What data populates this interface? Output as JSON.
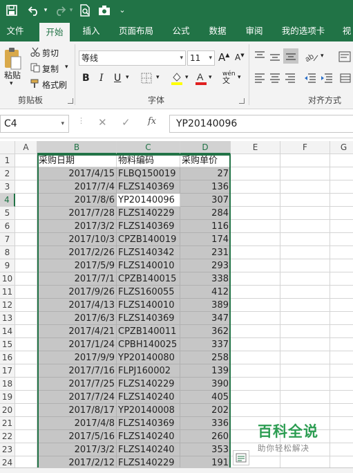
{
  "qat": {
    "save_icon": "save-icon",
    "undo_icon": "undo-icon",
    "redo_icon": "redo-icon",
    "print_preview_icon": "print-preview-icon",
    "camera_icon": "camera-icon",
    "customize_icon": "customize-qat-icon"
  },
  "tabs": [
    "文件",
    "开始",
    "插入",
    "页面布局",
    "公式",
    "数据",
    "审阅",
    "我的选项卡",
    "视"
  ],
  "active_tab": "开始",
  "ribbon": {
    "clipboard": {
      "paste": "粘贴",
      "cut": "剪切",
      "copy": "复制",
      "format_painter": "格式刷",
      "label": "剪贴板"
    },
    "font": {
      "font_name": "等线",
      "font_size": "11",
      "grow": "A",
      "shrink": "A",
      "bold": "B",
      "italic": "I",
      "underline": "U",
      "phonetic": "wén",
      "label": "字体"
    },
    "alignment": {
      "label": "对齐方式"
    }
  },
  "formula_bar": {
    "name_box": "C4",
    "fx": "fx",
    "content": "YP20140096"
  },
  "columns": [
    "A",
    "B",
    "C",
    "D",
    "E",
    "F",
    "G"
  ],
  "selected_columns": [
    "B",
    "C",
    "D"
  ],
  "active_row": 4,
  "rows": [
    {
      "n": 1,
      "b": "采购日期",
      "c": "物料编码",
      "d": "采购单价"
    },
    {
      "n": 2,
      "b": "2017/4/15",
      "c": "FLBQ150019",
      "d": "27"
    },
    {
      "n": 3,
      "b": "2017/7/4",
      "c": "FLZS140369",
      "d": "136"
    },
    {
      "n": 4,
      "b": "2017/8/6",
      "c": "YP20140096",
      "d": "307"
    },
    {
      "n": 5,
      "b": "2017/7/28",
      "c": "FLZS140229",
      "d": "284"
    },
    {
      "n": 6,
      "b": "2017/3/2",
      "c": "FLZS140369",
      "d": "116"
    },
    {
      "n": 7,
      "b": "2017/10/3",
      "c": "CPZB140019",
      "d": "174"
    },
    {
      "n": 8,
      "b": "2017/2/26",
      "c": "FLZS140342",
      "d": "231"
    },
    {
      "n": 9,
      "b": "2017/5/9",
      "c": "FLZS140010",
      "d": "293"
    },
    {
      "n": 10,
      "b": "2017/7/1",
      "c": "CPZB140015",
      "d": "338"
    },
    {
      "n": 11,
      "b": "2017/9/26",
      "c": "FLZS160055",
      "d": "412"
    },
    {
      "n": 12,
      "b": "2017/4/13",
      "c": "FLZS140010",
      "d": "389"
    },
    {
      "n": 13,
      "b": "2017/6/3",
      "c": "FLZS140369",
      "d": "347"
    },
    {
      "n": 14,
      "b": "2017/4/21",
      "c": "CPZB140011",
      "d": "362"
    },
    {
      "n": 15,
      "b": "2017/1/24",
      "c": "CPBH140025",
      "d": "337"
    },
    {
      "n": 16,
      "b": "2017/9/9",
      "c": "YP20140080",
      "d": "258"
    },
    {
      "n": 17,
      "b": "2017/7/16",
      "c": "FLPJ160002",
      "d": "139"
    },
    {
      "n": 18,
      "b": "2017/7/25",
      "c": "FLZS140229",
      "d": "390"
    },
    {
      "n": 19,
      "b": "2017/7/24",
      "c": "FLZS140240",
      "d": "405"
    },
    {
      "n": 20,
      "b": "2017/8/17",
      "c": "YP20140008",
      "d": "202"
    },
    {
      "n": 21,
      "b": "2017/4/8",
      "c": "FLZS140369",
      "d": "336"
    },
    {
      "n": 22,
      "b": "2017/5/16",
      "c": "FLZS140240",
      "d": "260"
    },
    {
      "n": 23,
      "b": "2017/3/2",
      "c": "FLZS140240",
      "d": "353"
    },
    {
      "n": 24,
      "b": "2017/2/12",
      "c": "FLZS140229",
      "d": "191"
    }
  ],
  "watermark": {
    "title": "百科全说",
    "subtitle": "助你轻松解决"
  },
  "colors": {
    "excel_green": "#217346",
    "selection_gray": "#c6c6c6"
  }
}
